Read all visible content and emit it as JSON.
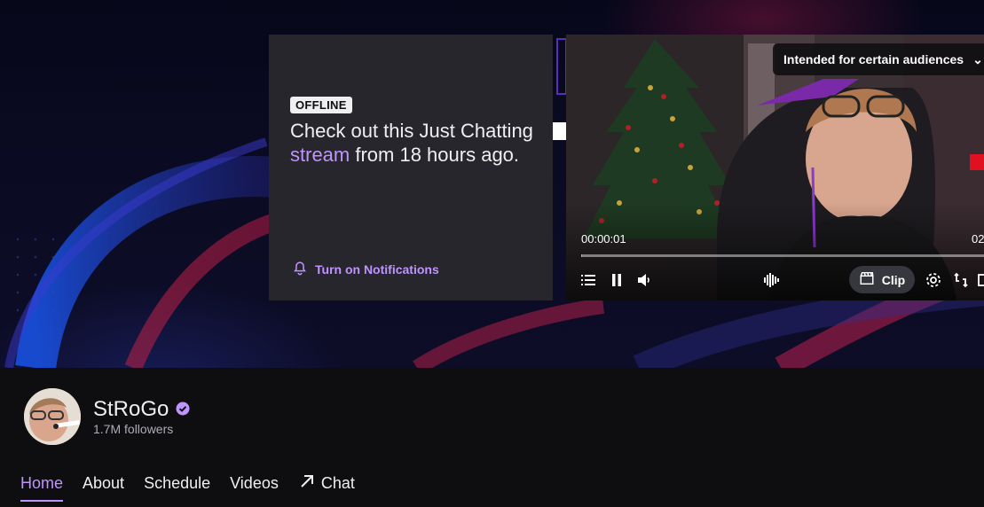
{
  "offline_card": {
    "badge": "OFFLINE",
    "message_before": "Check out this Just Chatting ",
    "message_link": "stream",
    "message_after": " from 18 hours ago.",
    "notifications_label": "Turn on Notifications"
  },
  "player": {
    "audience_label": "Intended for certain audiences",
    "time_current": "00:00:01",
    "time_end": "02",
    "progress_fraction": 0.002,
    "clip_label": "Clip"
  },
  "channel": {
    "name": "StRoGo",
    "followers": "1.7M followers"
  },
  "tabs": [
    {
      "label": "Home",
      "active": true
    },
    {
      "label": "About",
      "active": false
    },
    {
      "label": "Schedule",
      "active": false
    },
    {
      "label": "Videos",
      "active": false
    },
    {
      "label": "Chat",
      "active": false
    }
  ],
  "colors": {
    "accent": "#bf94ff",
    "background": "#0e0e10",
    "card": "#26262c"
  }
}
